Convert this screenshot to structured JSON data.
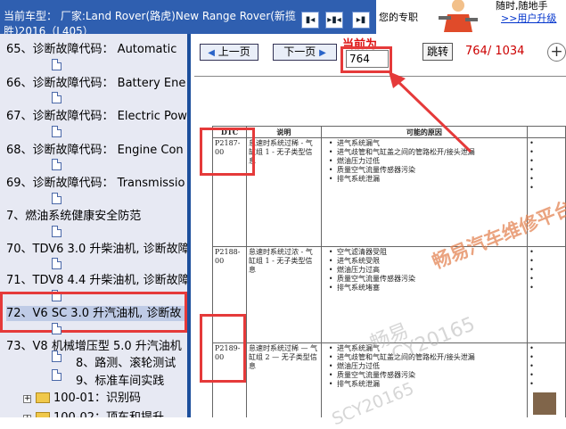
{
  "header": {
    "vehicle_label": "当前车型： 厂家:Land Rover(路虎)New Range Rover(新揽胜)2016（L405）",
    "nav_first": "▮◂",
    "nav_prev": "▸▮◂",
    "nav_next": "▸▮"
  },
  "promo": {
    "line1": "您的专职",
    "line2": "随时,随地手",
    "line3": ">>用户升级"
  },
  "tree": {
    "items": [
      {
        "label": "65、诊断故障代码： Automatic"
      },
      {
        "label": "66、诊断故障代码： Battery Ene"
      },
      {
        "label": "67、诊断故障代码： Electric Pow"
      },
      {
        "label": "68、诊断故障代码： Engine Con"
      },
      {
        "label": "69、诊断故障代码： Transmissio"
      },
      {
        "label": "7、燃油系统健康安全防范"
      },
      {
        "label": "70、TDV6 3.0 升柴油机, 诊断故障"
      },
      {
        "label": "71、TDV8 4.4 升柴油机, 诊断故障"
      },
      {
        "label": "72、V6 SC 3.0 升汽油机, 诊断故"
      },
      {
        "label": "73、V8 机械增压型 5.0 升汽油机"
      },
      {
        "label": "8、路测、滚轮测试"
      },
      {
        "label": "9、标准车间实践"
      },
      {
        "label": "100-01：识别码"
      },
      {
        "label": "100-02：顶车和提升"
      }
    ]
  },
  "viewer": {
    "prev_label": "上一页",
    "next_label": "下一页",
    "current_label": "当前为",
    "page_value": "764",
    "jump_label": "跳转",
    "counter": "764/ 1034",
    "zoom_in": "+"
  },
  "doc": {
    "headers": [
      "DTC",
      "说明",
      "可能的原因"
    ],
    "rows": [
      {
        "dtc": "P2187-00",
        "desc": "怠速时系统过稀 - 气缸组 1 - 无子类型信息",
        "causes": [
          "进气系统漏气",
          "进气歧管和气缸盖之间的管路松开/接头泄漏",
          "燃油压力过低",
          "质量空气流量传感器污染",
          "排气系统泄漏"
        ]
      },
      {
        "dtc": "P2188-00",
        "desc": "怠速时系统过浓 - 气缸组 1 - 无子类型信息",
        "causes": [
          "空气滤清器受阻",
          "进气系统受限",
          "燃油压力过高",
          "质量空气流量传感器污染",
          "排气系统堵塞"
        ]
      },
      {
        "dtc": "P2189-00",
        "desc": "怠速时系统过稀 — 气缸组 2 — 无子类型信息",
        "causes": [
          "进气系统漏气",
          "进气歧管和气缸盖之间的管路松开/接头泄漏",
          "燃油压力过低",
          "质量空气流量传感器污染",
          "排气系统泄漏"
        ]
      }
    ]
  },
  "watermark": {
    "brand": "畅易汽车维修平台",
    "faint1": "畅易",
    "faint2": "CY20165",
    "faint3": "SCY20165"
  },
  "colors": {
    "title_bar": "#2f5fb0",
    "tree_bg": "#e7e9f3",
    "highlight_red": "#e53a3a",
    "counter_red": "#cc0000"
  }
}
